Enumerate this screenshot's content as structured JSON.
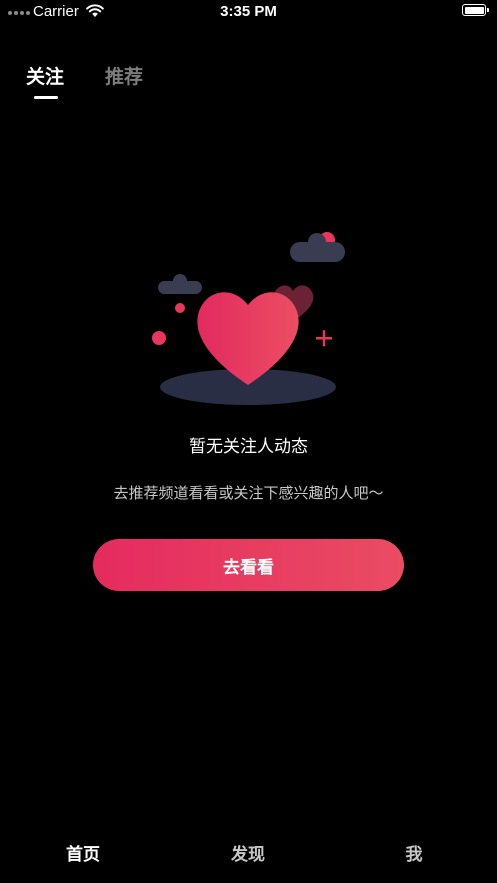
{
  "status_bar": {
    "carrier": "Carrier",
    "time": "3:35 PM"
  },
  "top_tabs": [
    {
      "label": "关注",
      "active": true
    },
    {
      "label": "推荐",
      "active": false
    }
  ],
  "empty_state": {
    "title": "暂无关注人动态",
    "subtitle": "去推荐频道看看或关注下感兴趣的人吧～",
    "button_label": "去看看",
    "illustration_icon": "heart-with-clouds"
  },
  "bottom_nav": [
    {
      "label": "首页",
      "active": true
    },
    {
      "label": "发现",
      "active": false
    },
    {
      "label": "我",
      "active": false
    }
  ],
  "colors": {
    "background": "#000000",
    "accent_start": "#e52b5f",
    "accent_end": "#ea4c63",
    "inactive_tab": "#7c7c7c"
  }
}
